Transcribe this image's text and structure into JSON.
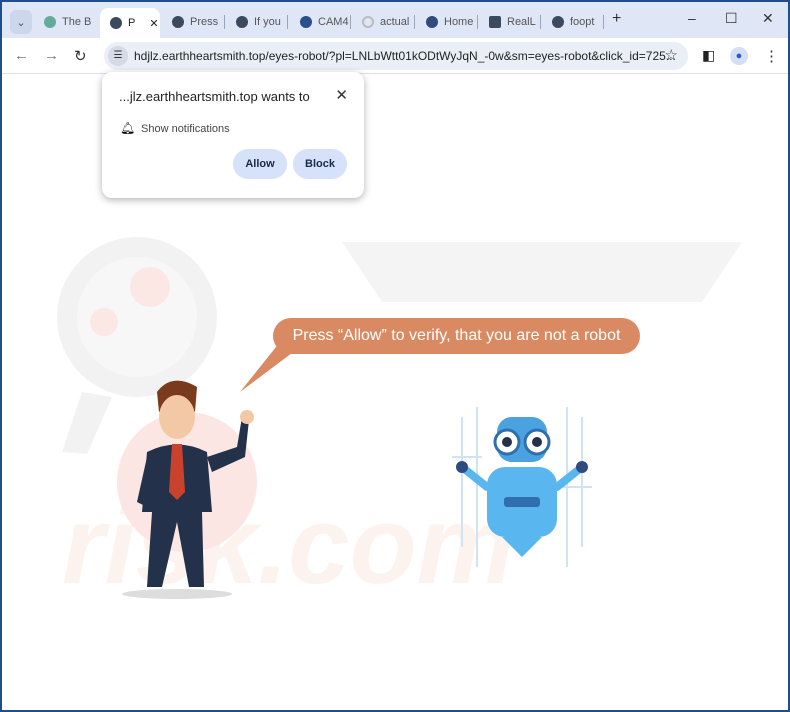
{
  "tabs": [
    {
      "label": "The B",
      "icon": "vine-icon"
    },
    {
      "label": "P",
      "icon": "globe-icon",
      "active": true
    },
    {
      "label": "Press",
      "icon": "globe-icon"
    },
    {
      "label": "If you",
      "icon": "globe-icon"
    },
    {
      "label": "CAM4",
      "icon": "cam-icon"
    },
    {
      "label": "actual",
      "icon": "loading-icon"
    },
    {
      "label": "Home",
      "icon": "opera-icon"
    },
    {
      "label": "RealL",
      "icon": "r-icon"
    },
    {
      "label": "foopt",
      "icon": "globe-icon"
    }
  ],
  "address": {
    "url": "hdjlz.earthheartsmith.top/eyes-robot/?pl=LNLbWtt01kODtWyJqN_-0w&sm=eyes-robot&click_id=725..."
  },
  "popup": {
    "title": "...jlz.earthheartsmith.top wants to",
    "permission": "Show notifications",
    "allow": "Allow",
    "block": "Block"
  },
  "page": {
    "bubble": "Press “Allow” to verify, that you are not a robot",
    "watermark": "risk.com",
    "bubble_color": "#d98a62"
  }
}
